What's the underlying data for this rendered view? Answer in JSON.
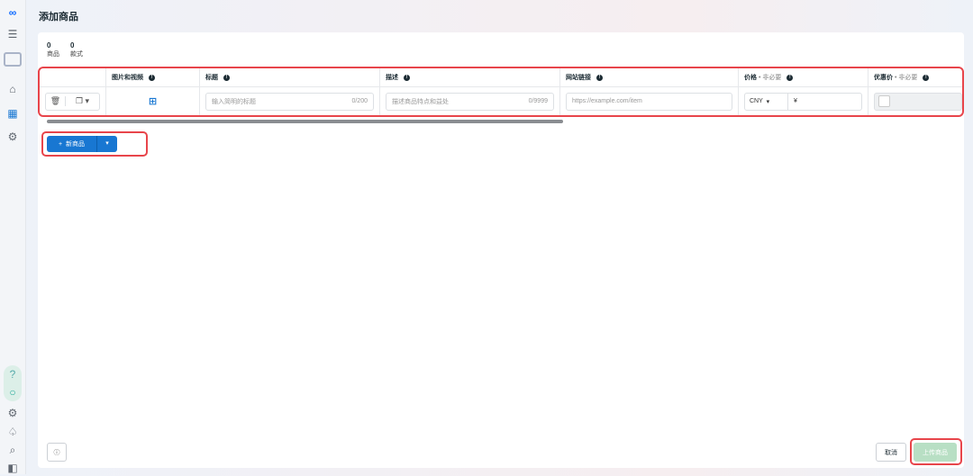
{
  "page": {
    "title": "添加商品"
  },
  "stats": [
    {
      "value": "0",
      "label": "商品"
    },
    {
      "value": "0",
      "label": "款式"
    }
  ],
  "table": {
    "headers": {
      "media": "图片和视频",
      "title": "标题",
      "description": "描述",
      "url": "网站链接",
      "price": "价格",
      "sale_price": "优惠价",
      "optional": "• 非必要"
    },
    "row": {
      "title_placeholder": "输入简明的标题",
      "title_count": "0/200",
      "desc_placeholder": "描述商品特点和益处",
      "desc_count": "0/9999",
      "url_placeholder": "https://example.com/item",
      "currency": "CNY",
      "currency_symbol": "¥"
    }
  },
  "actions": {
    "new_product": "新商品",
    "cancel": "取消",
    "upload": "上传商品"
  },
  "colors": {
    "accent": "#1877d2",
    "highlight": "#e8454b"
  }
}
